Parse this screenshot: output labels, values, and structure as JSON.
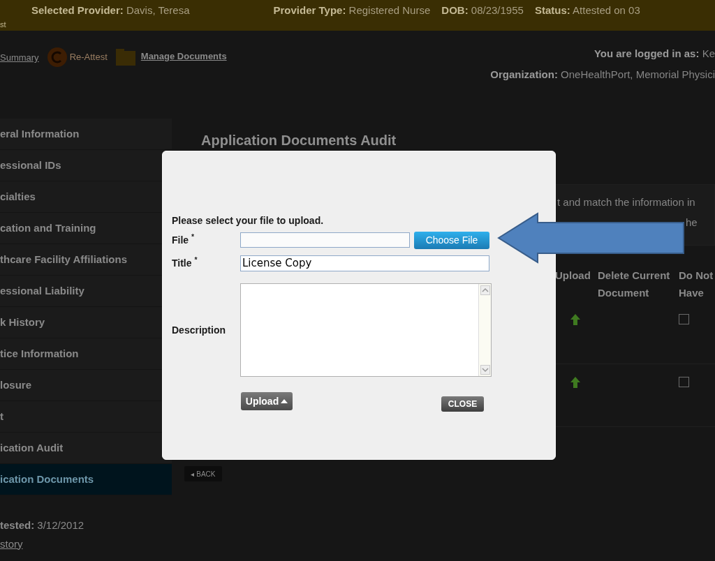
{
  "header": {
    "fields": [
      {
        "label": "Selected Provider:",
        "value": "Davis, Teresa"
      },
      {
        "label": "Provider Type:",
        "value": "Registered Nurse"
      },
      {
        "label": "DOB:",
        "value": "08/23/1955"
      },
      {
        "label": "Status:",
        "value": "Attested on 03"
      }
    ],
    "overflow_text": "st"
  },
  "toolbar": {
    "links": [
      {
        "kind": "link",
        "label": "Summary"
      },
      {
        "kind": "reattest",
        "label": "Re-Attest"
      },
      {
        "kind": "folder",
        "label": "Manage Documents"
      }
    ],
    "logged_in": {
      "label": "You are logged in as:",
      "value": "Ke"
    },
    "organization": {
      "label": "Organization:",
      "value": "OneHealthPort, Memorial Physici"
    }
  },
  "sidebar": {
    "items": [
      {
        "label": "eral Information",
        "selected": false
      },
      {
        "label": "essional IDs",
        "selected": false
      },
      {
        "label": "cialties",
        "selected": false
      },
      {
        "label": "cation and Training",
        "selected": false
      },
      {
        "label": "thcare Facility Affiliations",
        "selected": false
      },
      {
        "label": "essional Liability",
        "selected": false
      },
      {
        "label": "k History",
        "selected": false
      },
      {
        "label": "tice Information",
        "selected": false
      },
      {
        "label": "losure",
        "selected": false
      },
      {
        "label": "t",
        "selected": false
      },
      {
        "label": "ication Audit",
        "selected": false
      },
      {
        "label": "ication Documents",
        "selected": true
      }
    ],
    "attested": "**tested:** 3/12/2012",
    "history_link": "story"
  },
  "main": {
    "title": "Application Documents Audit",
    "notice_lines": [
      "t and match the information in",
      "he"
    ],
    "table": {
      "columns": [
        "Upload",
        "Delete Current Document",
        "Do Not Have"
      ],
      "rows": [
        {
          "do_not_have": false
        },
        {
          "do_not_have": false
        }
      ]
    },
    "back_button": "◂ BACK"
  },
  "dialog": {
    "prompt": "Please select your file to upload.",
    "fields": [
      {
        "kind": "file",
        "label": "File $^{*}$",
        "button": "Choose File"
      },
      {
        "kind": "text",
        "label": "Title $^{*}$",
        "value": "License Copy"
      },
      {
        "kind": "textarea",
        "label": "Description"
      }
    ],
    "upload_button": "Upload",
    "close_button": "CLOSE"
  }
}
